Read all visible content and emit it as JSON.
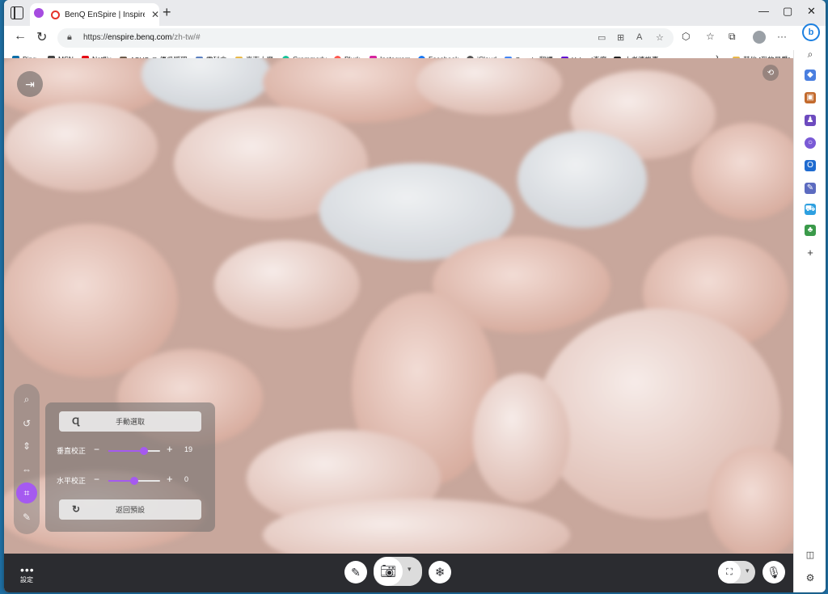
{
  "browser": {
    "tab": {
      "title": "BenQ EnSpire | Inspire peo",
      "close": "✕"
    },
    "new_tab": "+",
    "window_controls": [
      "—",
      "▢",
      "✕"
    ],
    "url": {
      "scheme": "https://",
      "host": "enspire.benq.com",
      "path": "/zh-tw/#"
    },
    "bookmarks": [
      {
        "label": "Bing",
        "color": "#0c6ea8"
      },
      {
        "label": "MSN",
        "color": "#444444"
      },
      {
        "label": "Netflix",
        "color": "#e50914"
      },
      {
        "label": "ASUS @ 優瓜狐理…",
        "color": "#6b5a4a"
      },
      {
        "label": "需科會",
        "color": "#5b7fbf"
      },
      {
        "label": "臺南大學",
        "color": "#e9b949"
      },
      {
        "label": "Grammarly",
        "color": "#15c39a"
      },
      {
        "label": "Plurk",
        "color": "#ff574d"
      },
      {
        "label": "Instagram",
        "color": "#d6249f"
      },
      {
        "label": "Facebook",
        "color": "#1877f2"
      },
      {
        "label": "iCloud",
        "color": "#555555"
      },
      {
        "label": "Google 翻譯",
        "color": "#4285f4"
      },
      {
        "label": "Yahoo!奇摩",
        "color": "#6001d2"
      },
      {
        "label": "小老婆機車",
        "color": "#222222"
      }
    ],
    "bookmarks_more": "›",
    "other_bookmarks": "其他 [我的最愛]"
  },
  "app": {
    "panel": {
      "manual_select_label": "手動選取",
      "vertical_label": "垂直校正",
      "vertical_value": "19",
      "vertical_level": 0.68,
      "horizontal_label": "水平校正",
      "horizontal_value": "0",
      "horizontal_level": 0.5,
      "reset_label": "返回預設",
      "minus": "−",
      "plus": "+"
    },
    "bottom": {
      "settings_label": "設定",
      "dropdown": "▾"
    }
  },
  "icons": {
    "exit": "exit-icon",
    "camera_toggle": "camera-switch-icon",
    "zoom": "zoom-icon",
    "rotate": "rotate-icon",
    "flip_vertical": "flip-vertical-icon",
    "flip_horizontal": "flip-horizontal-icon",
    "keystone": "keystone-icon",
    "pen": "pen-icon",
    "camera": "camera-icon",
    "freeze": "snowflake-icon",
    "ocr": "ocr-icon",
    "microphone": "microphone-icon"
  },
  "colors": {
    "accent": "#a55af0",
    "bottom_bar": "#2b2c30"
  }
}
